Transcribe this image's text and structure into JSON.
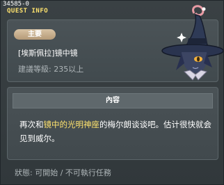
{
  "header": {
    "quest_id": "34585-0",
    "title": "QUEST INFO"
  },
  "quest": {
    "type_badge": "主要",
    "name": "[埃斯佩拉]镜中镜",
    "level_req": "建議等級: 235以上"
  },
  "content": {
    "header": "內容",
    "text_before": "再次和",
    "highlight": "镜中的光明神座",
    "text_after": "的梅尔朗谈谈吧。估计很快就会见到威尔。",
    "highlight_color": "#ffe36e"
  },
  "status": {
    "text": "狀態: 可開始 / 不可執行任務"
  },
  "npc": {
    "icon": "witch-npc-portrait"
  }
}
